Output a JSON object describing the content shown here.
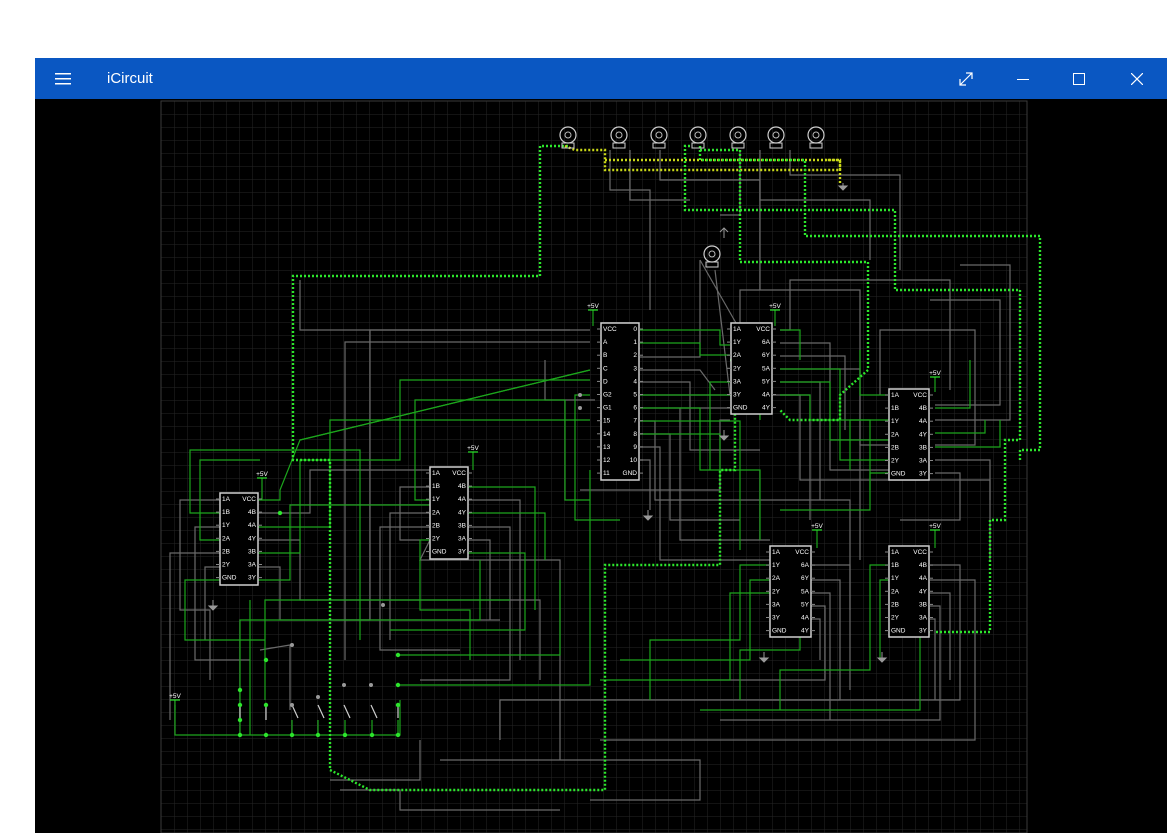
{
  "window": {
    "title": "iCircuit"
  },
  "icons": {
    "menu": "hamburger-menu-icon",
    "fullscreen": "expand-diagonal-icon",
    "minimize": "minimize-icon",
    "maximize": "maximize-icon",
    "close": "close-icon"
  },
  "colors": {
    "titlebar": "#0a57c2",
    "canvas_bg": "#000000",
    "grid": "#2a2a2a",
    "wire_active": "#1ca51c",
    "wire_idle": "#6a6a6a",
    "wire_signal": "#c9d818"
  },
  "circuit": {
    "supply_label": "+5V",
    "decoder": {
      "left_pins": [
        "VCC",
        "A",
        "B",
        "C",
        "D",
        "G2",
        "G1",
        "15",
        "14",
        "13",
        "12",
        "11"
      ],
      "right_pins": [
        "0",
        "1",
        "2",
        "3",
        "4",
        "5",
        "6",
        "7",
        "8",
        "9",
        "10",
        "GND"
      ]
    },
    "hex_inverter": {
      "left_pins": [
        "1A",
        "1Y",
        "2A",
        "2Y",
        "3A",
        "3Y",
        "GND"
      ],
      "right_pins": [
        "VCC",
        "6A",
        "6Y",
        "5A",
        "5Y",
        "4A",
        "4Y"
      ]
    },
    "quad_gate": {
      "left_pins": [
        "1A",
        "1B",
        "1Y",
        "2A",
        "2B",
        "2Y",
        "GND"
      ],
      "right_pins": [
        "VCC",
        "4B",
        "4A",
        "4Y",
        "3B",
        "3A",
        "3Y"
      ]
    }
  }
}
